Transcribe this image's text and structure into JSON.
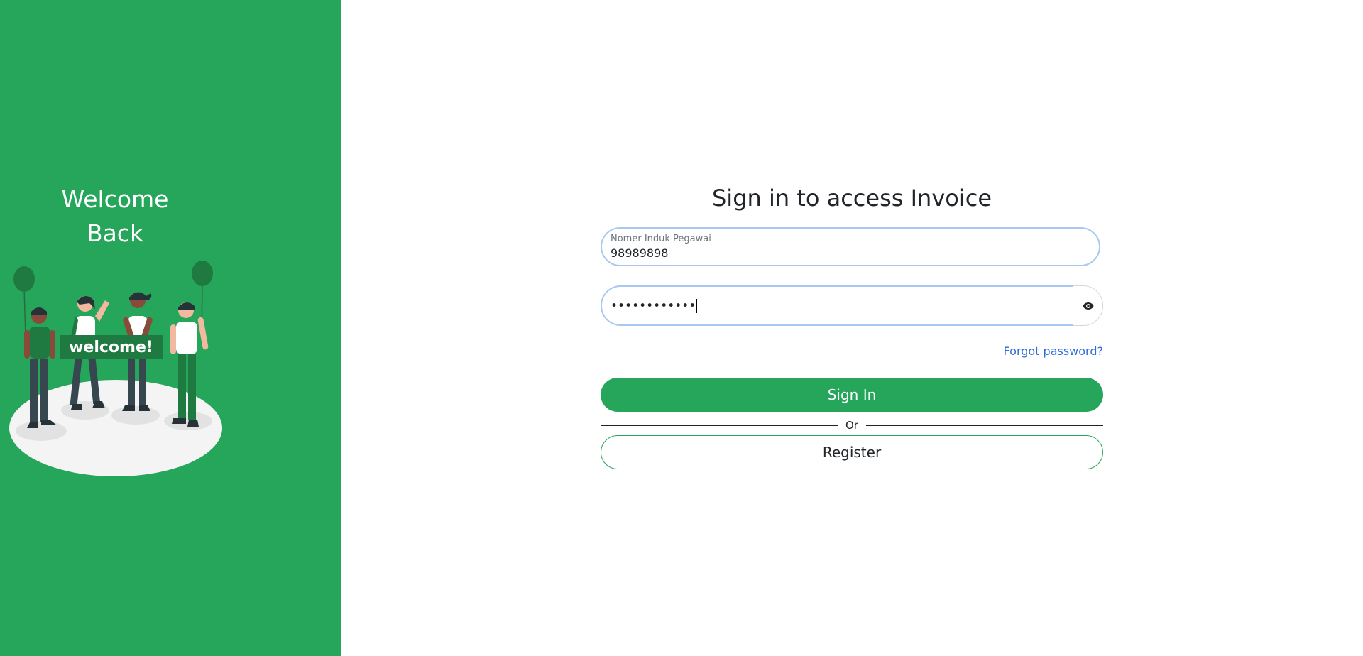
{
  "left_panel": {
    "welcome_line1": "Welcome",
    "welcome_line2": "Back",
    "banner_text": "welcome!",
    "bg_color": "#26a65b"
  },
  "form": {
    "heading": "Sign in to access Invoice",
    "nip_label": "Nomer Induk Pegawai",
    "nip_value": "98989898",
    "password_value": "••••••••••••",
    "show_password_icon": "eye-icon",
    "forgot_password": "Forgot password?",
    "signin_label": "Sign In",
    "divider_text": "Or",
    "register_label": "Register",
    "accent_color": "#26a65b",
    "link_color": "#2d6bd9",
    "focus_border_color": "#a8c8f0"
  }
}
